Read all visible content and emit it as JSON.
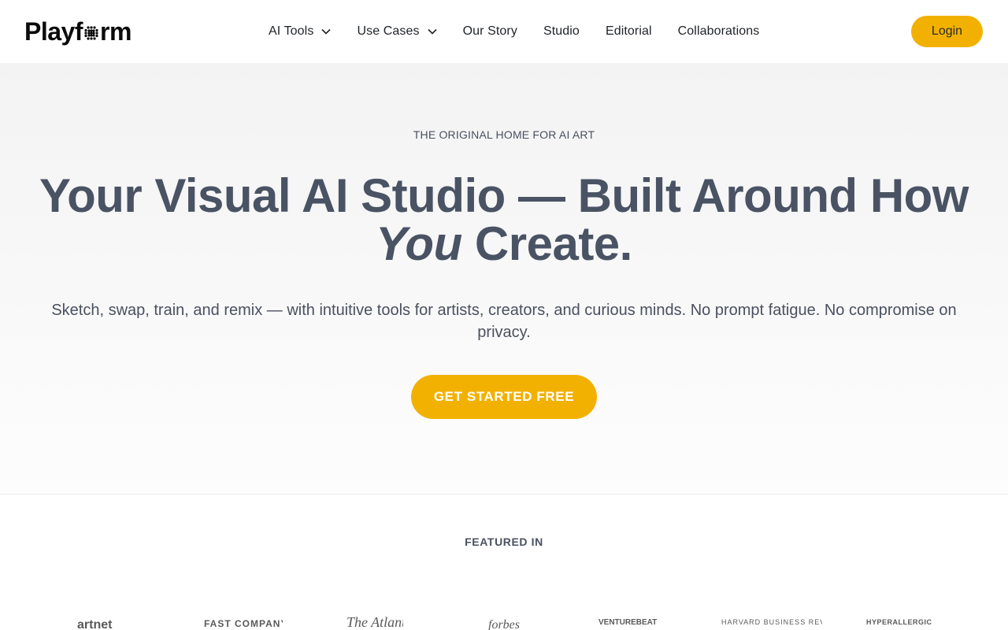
{
  "header": {
    "logo": {
      "before": "Playf",
      "after": "rm"
    },
    "nav": [
      {
        "label": "AI Tools",
        "has_dropdown": true
      },
      {
        "label": "Use Cases",
        "has_dropdown": true
      },
      {
        "label": "Our Story",
        "has_dropdown": false
      },
      {
        "label": "Studio",
        "has_dropdown": false
      },
      {
        "label": "Editorial",
        "has_dropdown": false
      },
      {
        "label": "Collaborations",
        "has_dropdown": false
      }
    ],
    "login_label": "Login"
  },
  "hero": {
    "eyebrow": "THE ORIGINAL HOME FOR AI ART",
    "headline_line1": "Your Visual AI Studio — Built Around How",
    "headline_emphasis": "You",
    "headline_line2_rest": " Create.",
    "subtext": "Sketch, swap, train, and remix — with intuitive tools for artists, creators, and curious minds. No prompt fatigue. No compromise on privacy.",
    "cta_label": "GET STARTED FREE"
  },
  "featured": {
    "label": "FEATURED IN",
    "logos": [
      "artnet",
      "FAST COMPANY",
      "The Atlantic",
      "forbes",
      "VENTUREBEAT",
      "HARVARD BUSINESS REVIEW",
      "HYPERALLERGIC"
    ]
  },
  "colors": {
    "accent": "#f2b100",
    "headline": "#4a5364",
    "body_text": "#4a5060"
  },
  "icons": {
    "chevron": "chevron-down-icon",
    "logo_mark": "dotted-o-icon"
  }
}
